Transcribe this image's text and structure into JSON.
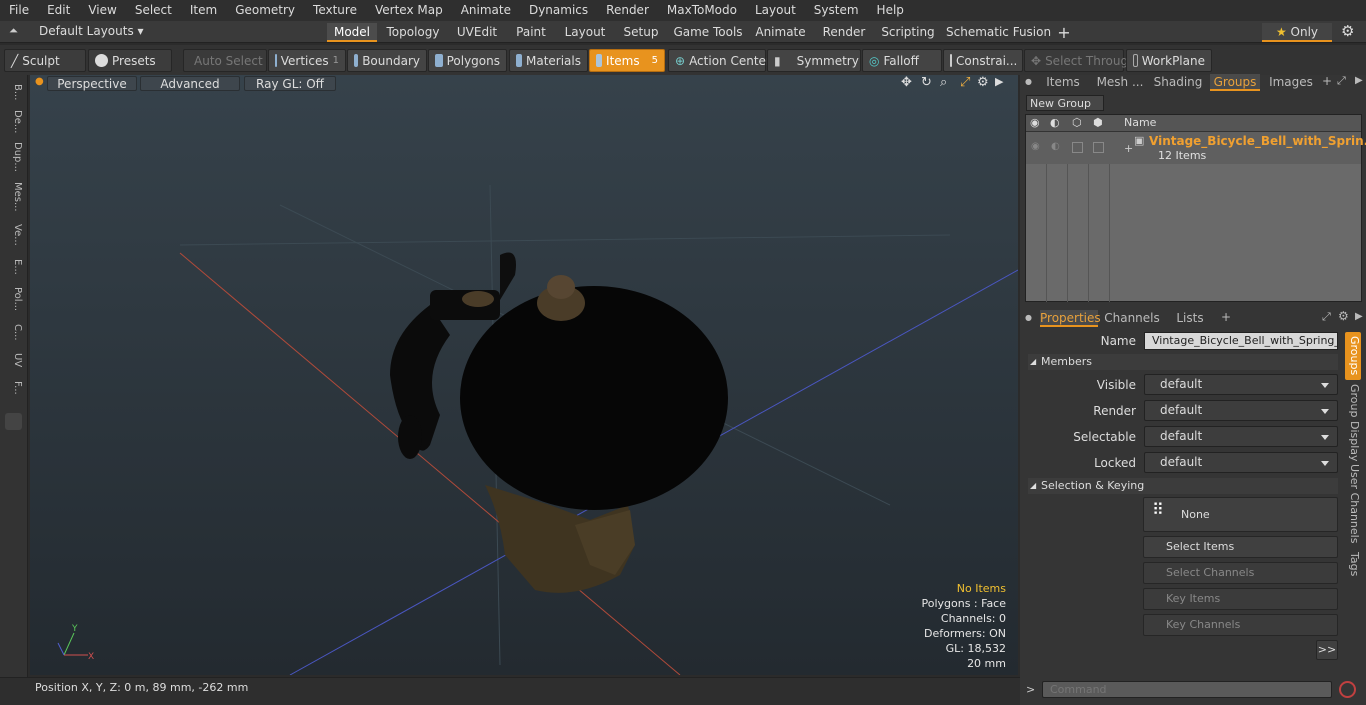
{
  "menubar": {
    "items": [
      "File",
      "Edit",
      "View",
      "Select",
      "Item",
      "Geometry",
      "Texture",
      "Vertex Map",
      "Animate",
      "Dynamics",
      "Render",
      "MaxToModo",
      "Layout",
      "System",
      "Help"
    ]
  },
  "layout_selector": {
    "label": "Default Layouts ▾"
  },
  "layout_tabs": [
    "Model",
    "Topology",
    "UVEdit",
    "Paint",
    "Layout",
    "Setup",
    "Game Tools",
    "Animate",
    "Render",
    "Scripting",
    "Schematic Fusion"
  ],
  "layout_add": "+",
  "only_label": "Only",
  "toolbar": {
    "sculpt": "Sculpt",
    "presets": "Presets",
    "auto_select": "Auto Select",
    "vertices": "Vertices",
    "vertices_count": "1",
    "boundary": "Boundary",
    "polygons": "Polygons",
    "materials": "Materials",
    "items": "Items",
    "items_count": "5",
    "action_center": "Action Center",
    "symmetry": "Symmetry",
    "falloff": "Falloff",
    "constraints": "Constrai...",
    "select_through": "Select Through",
    "workplane": "WorkPlane"
  },
  "left_tabs": [
    "B...",
    "De...",
    "Dup...",
    "Mes...",
    "Ve...",
    "E...",
    "Pol...",
    "C...",
    "UV",
    "F..."
  ],
  "viewport": {
    "mode": "Perspective",
    "shading": "Advanced",
    "raygl": "Ray GL: Off",
    "stats": {
      "no_items": "No Items",
      "polygons": "Polygons : Face",
      "channels": "Channels: 0",
      "deformers": "Deformers: ON",
      "gl": "GL: 18,532",
      "scale": "20 mm"
    }
  },
  "statusbar": {
    "position": "Position X, Y, Z:   0 m, 89 mm, -262 mm"
  },
  "upper_tabs": [
    "Items",
    "Mesh ...",
    "Shading",
    "Groups",
    "Images"
  ],
  "groups": {
    "new_group": "New Group",
    "name_header": "Name",
    "group_name": "Vintage_Bicycle_Bell_with_Sprin...",
    "group_count": "12 Items"
  },
  "lower_tabs": [
    "Properties",
    "Channels",
    "Lists"
  ],
  "properties": {
    "name_label": "Name",
    "name_value": "Vintage_Bicycle_Bell_with_Spring_Han",
    "members": "Members",
    "visible_label": "Visible",
    "render_label": "Render",
    "selectable_label": "Selectable",
    "locked_label": "Locked",
    "default_value": "default",
    "sel_keying": "Selection & Keying",
    "none": "None",
    "select_items": "Select Items",
    "select_channels": "Select Channels",
    "key_items": "Key Items",
    "key_channels": "Key Channels",
    "more": ">>"
  },
  "side_tabs": [
    "Groups",
    "Group Display",
    "User Channels",
    "Tags"
  ],
  "command_placeholder": "Command",
  "colors": {
    "accent": "#e8931e",
    "group_name": "#f0a030"
  }
}
